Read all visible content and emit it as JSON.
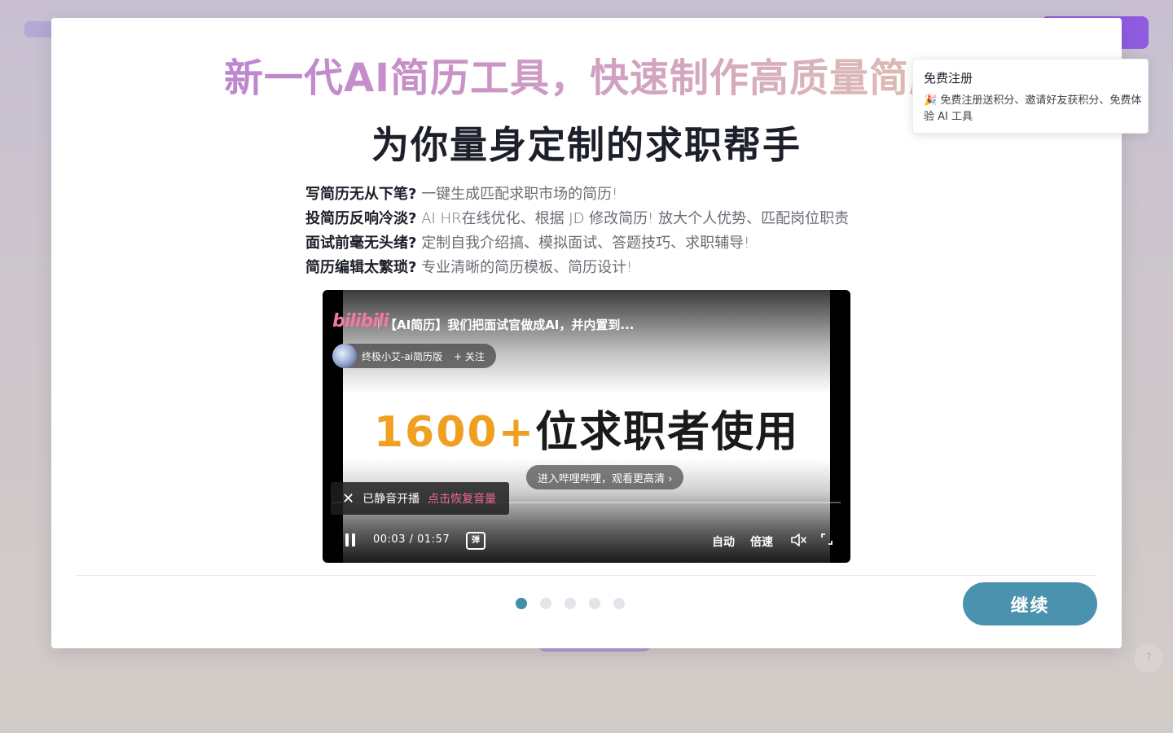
{
  "modal": {
    "hero_title": "新一代AI简历工具，快速制作高质量简历",
    "sub_title": "为你量身定制的求职帮手",
    "features": [
      {
        "q": "写简历无从下笔?",
        "a": "一键生成匹配求职市场的简历!"
      },
      {
        "q": "投简历反响冷淡?",
        "a": "AI HR在线优化、根据 JD 修改简历! 放大个人优势、匹配岗位职责"
      },
      {
        "q": "面试前毫无头绪?",
        "a": "定制自我介绍搞、模拟面试、答题技巧、求职辅导!"
      },
      {
        "q": "简历编辑太繁琐?",
        "a": "专业清晰的简历模板、简历设计!"
      }
    ],
    "continue_label": "继续",
    "pagination": {
      "total": 5,
      "current": 1
    }
  },
  "video": {
    "platform_logo": "bilibili",
    "title": "【AI简历】我们把面试官做成AI，并内置到...",
    "channel": "终极小艾-ai简历版",
    "follow_label": "+ 关注",
    "headline_number": "1600+",
    "headline_text": "位求职者使用",
    "enter_label": "进入哔哩哔哩，观看更高清 ›",
    "muted_text": "已静音开播",
    "restore_volume_label": "点击恢复音量",
    "current_time": "00:03",
    "time_sep": "/",
    "duration": "01:57",
    "danmaku_label": "弹",
    "auto_label": "自动",
    "speed_label": "倍速",
    "progress_percent": 3,
    "accent_color": "#00a1d6"
  },
  "popover": {
    "title": "免费注册",
    "body": "🎉 免费注册送积分、邀请好友获积分、免费体验 AI 工具"
  },
  "colors": {
    "primary": "#4a92ae",
    "dot_active": "#3f8fab",
    "dot_inactive": "#e2e5ea"
  }
}
